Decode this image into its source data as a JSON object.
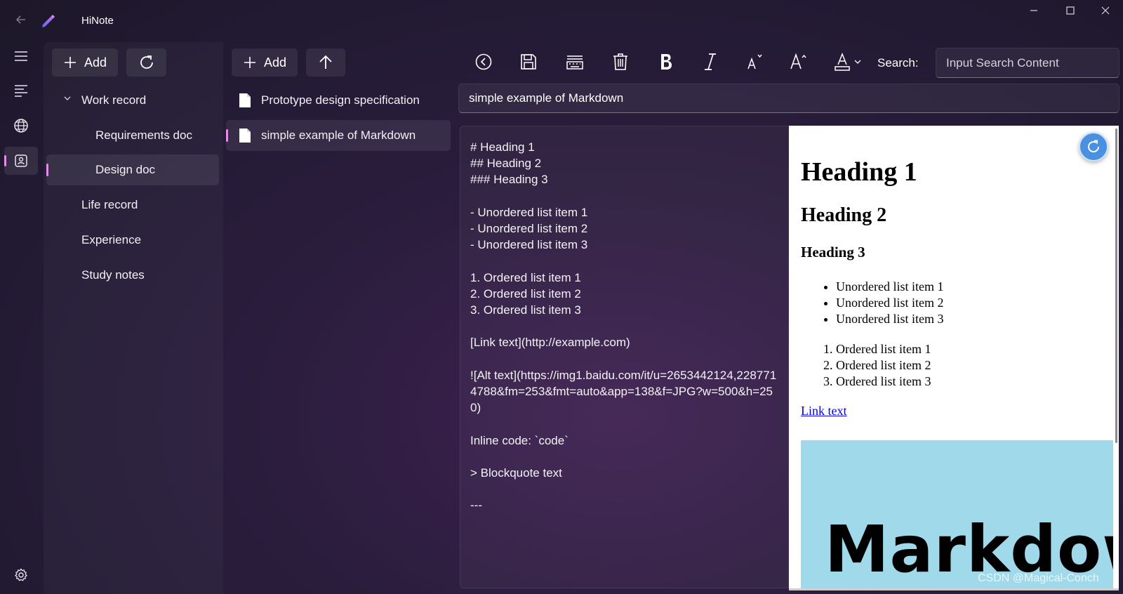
{
  "app": {
    "title": "HiNote"
  },
  "window_controls": {
    "minimize_icon": "minimize-icon",
    "maximize_icon": "maximize-icon",
    "close_icon": "close-icon"
  },
  "nav_rail": {
    "items": [
      {
        "icon": "hamburger-menu-icon"
      },
      {
        "icon": "list-icon"
      },
      {
        "icon": "globe-icon"
      },
      {
        "icon": "contact-card-icon",
        "active": true
      }
    ],
    "settings_icon": "gear-icon"
  },
  "tree_pane": {
    "add_label": "Add",
    "items": [
      {
        "label": "Work record",
        "expanded": true,
        "level": 0
      },
      {
        "label": "Requirements doc",
        "level": 1
      },
      {
        "label": "Design doc",
        "level": 1,
        "active": true
      },
      {
        "label": "Life record",
        "level": 0
      },
      {
        "label": "Experience",
        "level": 0
      },
      {
        "label": "Study notes",
        "level": 0
      }
    ]
  },
  "doc_pane": {
    "add_label": "Add",
    "items": [
      {
        "label": "Prototype design specification"
      },
      {
        "label": "simple example of Markdown",
        "active": true
      }
    ]
  },
  "toolbar": {
    "search_label": "Search:",
    "search_placeholder": "Input Search Content"
  },
  "editor": {
    "title_value": "simple example of Markdown",
    "content": "# Heading 1\n## Heading 2\n### Heading 3\n\n- Unordered list item 1\n- Unordered list item 2\n- Unordered list item 3\n\n1. Ordered list item 1\n2. Ordered list item 2\n3. Ordered list item 3\n\n[Link text](http://example.com)\n\n![Alt text](https://img1.baidu.com/it/u=2653442124,2287714788&fm=253&fmt=auto&app=138&f=JPG?w=500&h=250)\n\nInline code: `code`\n\n> Blockquote text\n\n---"
  },
  "preview": {
    "h1": "Heading 1",
    "h2": "Heading 2",
    "h3": "Heading 3",
    "unordered": [
      "Unordered list item 1",
      "Unordered list item 2",
      "Unordered list item 3"
    ],
    "ordered": [
      "Ordered list item 1",
      "Ordered list item 2",
      "Ordered list item 3"
    ],
    "link": "Link text",
    "image_text": "Markdown",
    "image_bg": "#9fd9ea"
  },
  "watermark": "CSDN @Magical-Conch",
  "colors": {
    "accent": "#e58be8",
    "fab": "#4a90e2"
  }
}
